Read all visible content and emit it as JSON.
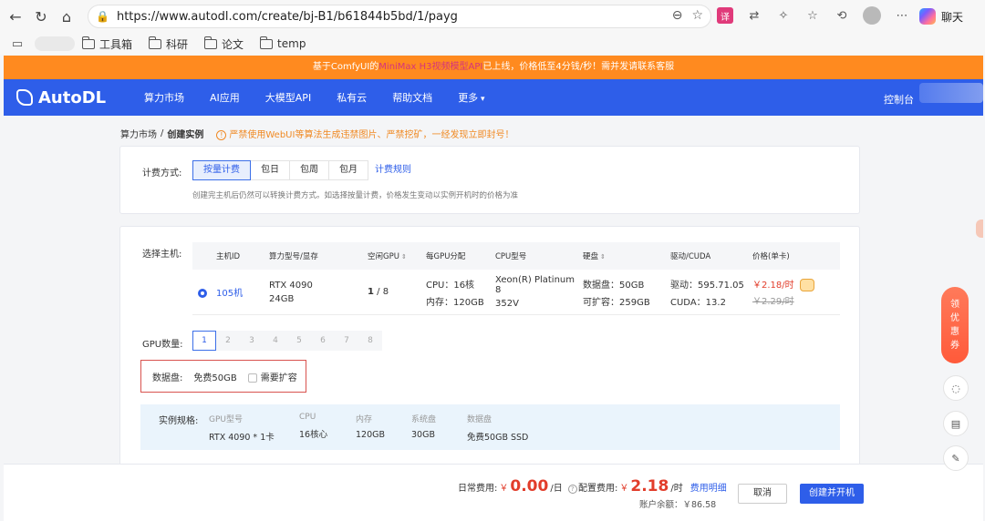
{
  "browser": {
    "url": "https://www.autodl.com/create/bj-B1/b61844b5bd/1/payg",
    "chat_label": "聊天",
    "bookmarks": [
      "工具箱",
      "科研",
      "论文",
      "temp"
    ]
  },
  "banner": {
    "prefix": "基于ComfyUI的",
    "highlight": "MiniMax H3视频模型API",
    "suffix": "已上线，价格低至4分钱/秒！需并发请联系客服"
  },
  "nav": {
    "logo": "AutoDL",
    "items": [
      "算力市场",
      "AI应用",
      "大模型API",
      "私有云",
      "帮助文档",
      "更多"
    ],
    "console": "控制台"
  },
  "breadcrumb": {
    "parent": "算力市场",
    "sep": "/",
    "current": "创建实例",
    "warning": "严禁使用WebUI等算法生成违禁图片、严禁挖矿，一经发现立即封号！"
  },
  "billing": {
    "label": "计费方式:",
    "options": [
      "按量计费",
      "包日",
      "包周",
      "包月"
    ],
    "active_index": 0,
    "rule_link": "计费规则",
    "hint": "创建完主机后仍然可以转换计费方式。如选择按量计费，价格发生变动以实例开机时的价格为准"
  },
  "host_select": {
    "label": "选择主机:",
    "headers": [
      "主机ID",
      "算力型号/显存",
      "空闲GPU",
      "每GPU分配",
      "CPU型号",
      "硬盘",
      "驱动/CUDA",
      "价格(单卡)"
    ],
    "row": {
      "id": "105机",
      "gpu_model": "RTX 4090",
      "vram": "24GB",
      "free_gpu": "1",
      "total_gpu": "/ 8",
      "cpu_alloc": "CPU：16核",
      "mem_alloc": "内存：120GB",
      "cpu_model_1": "Xeon(R) Platinum 8",
      "cpu_model_2": "352V",
      "data_disk": "数据盘：50GB",
      "expandable": "可扩容：259GB",
      "driver": "驱动：595.71.05",
      "cuda": "CUDA：13.2",
      "price": "￥2.18/时",
      "old_price": "￥2.29/时"
    }
  },
  "gpu_count": {
    "label": "GPU数量:",
    "options": [
      "1",
      "2",
      "3",
      "4",
      "5",
      "6",
      "7",
      "8"
    ],
    "active_index": 0
  },
  "data_disk": {
    "label": "数据盘:",
    "free": "免费50GB",
    "expand_label": "需要扩容"
  },
  "spec": {
    "label": "实例规格:",
    "columns": [
      {
        "h": "GPU型号",
        "v": "RTX 4090 * 1卡"
      },
      {
        "h": "CPU",
        "v": "16核心"
      },
      {
        "h": "内存",
        "v": "120GB"
      },
      {
        "h": "系统盘",
        "v": "30GB"
      },
      {
        "h": "数据盘",
        "v": "免费50GB SSD"
      }
    ]
  },
  "footer": {
    "daily_label": "日常费用:",
    "daily_yen": "￥",
    "daily_value": "0.00",
    "daily_unit": "/日",
    "config_label": "配置费用:",
    "config_yen": "￥",
    "config_value": "2.18",
    "config_unit": "/时",
    "fee_link": "费用明细",
    "balance": "账户余额：￥86.58",
    "cancel": "取消",
    "create": "创建并开机"
  },
  "side": {
    "coupon": [
      "领",
      "优",
      "惠",
      "券"
    ]
  },
  "colors": {
    "brand": "#2e5ee9",
    "banner": "#ff8a1f",
    "price": "#e23d2b"
  }
}
